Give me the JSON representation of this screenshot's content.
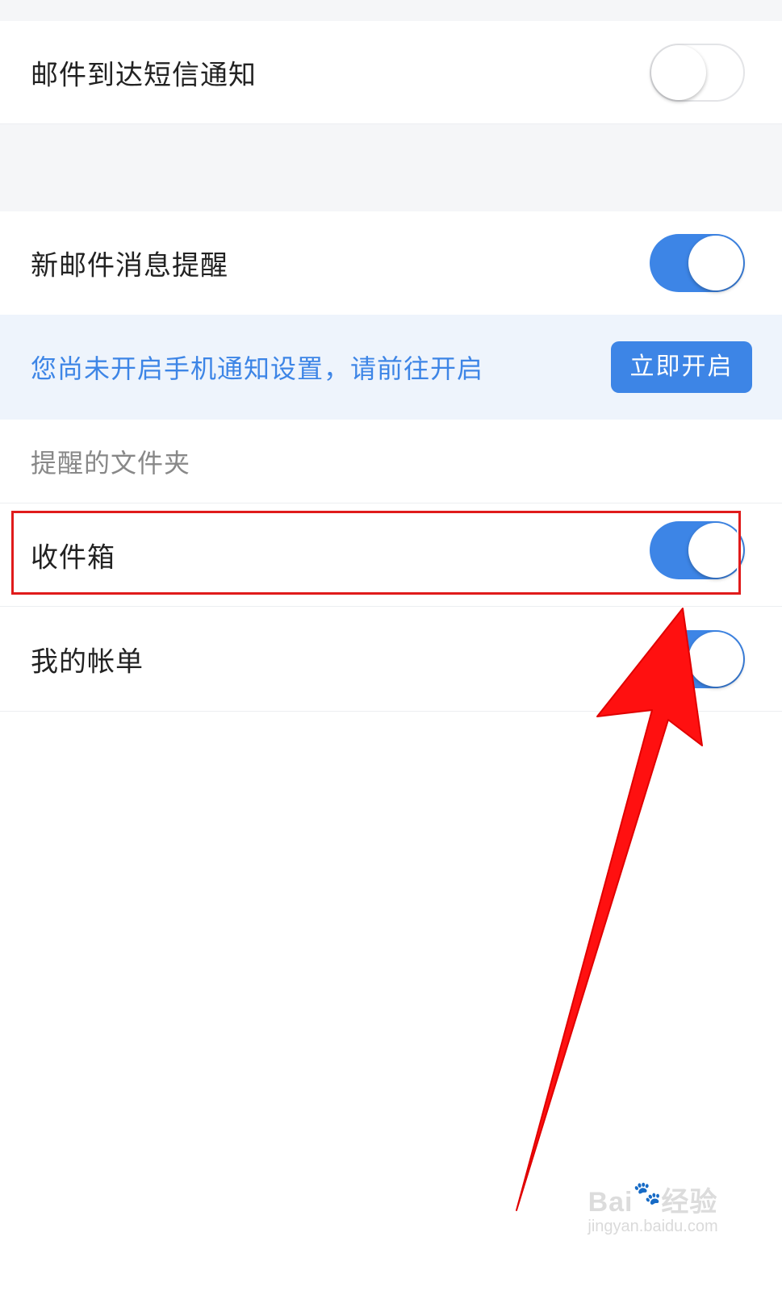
{
  "settings": {
    "sms_notify": {
      "label": "邮件到达短信通知",
      "enabled": false
    },
    "new_mail_alert": {
      "label": "新邮件消息提醒",
      "enabled": true
    },
    "notice": {
      "text": "您尚未开启手机通知设置，请前往开启",
      "button_label": "立即开启"
    },
    "folders_header": "提醒的文件夹",
    "folders": [
      {
        "label": "收件箱",
        "enabled": true
      },
      {
        "label": "我的帐单",
        "enabled": true
      }
    ]
  },
  "annotation": {
    "highlight_color": "#e01b1b",
    "arrow_color": "#ff0000"
  },
  "watermark": {
    "brand": "Bai",
    "brand_icon": "paw-icon",
    "brand_suffix": "经验",
    "url": "jingyan.baidu.com"
  },
  "colors": {
    "accent": "#3d85e6",
    "notice_bg": "#eef4fc",
    "gap_bg": "#f5f6f8"
  }
}
